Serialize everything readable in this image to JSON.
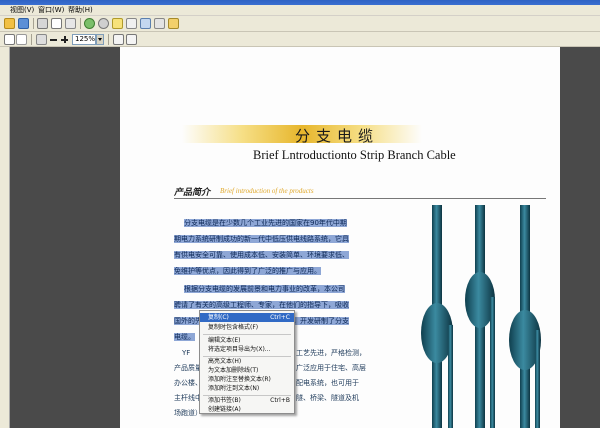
{
  "menubar": {
    "items": [
      "视图(V)",
      "窗口(W)",
      "帮助(H)"
    ]
  },
  "toolbar": {
    "zoom_value": "125%"
  },
  "document": {
    "title_cn": "分支电缆",
    "title_en": "Brief Lntroductionto Strip Branch Cable",
    "section_cn": "产品简介",
    "section_en": "Brief introduction of the products",
    "selected_lines": [
      "分支电缆是在少数几个工业先进的国家在90年代中期",
      "期电力系统研制成功的新一代中低压供电线路系统，它具",
      "有供电安全可靠、使用成本低、安装简单、环境要求低、",
      "免维护等优点，因此得到了广泛的推广与应用。",
      "根据分支电缆的发展前景和电力事业的改革，本公司",
      "聘请了有关的高级工程师、专家，在他们的指导下，吸收",
      "国外的先进技术，采用国内的先进材料，开发研制了分支",
      "电缆。"
    ],
    "lines_left": [
      "YF",
      "产品质量",
      "办公楼、",
      "主杆线中",
      "场跑道）"
    ],
    "lines_right": [
      "工艺先进，严格检测，",
      "广泛应用于住宅、高层",
      "配电系统，也可用于",
      "隧、桥梁、隧道及机",
      ""
    ]
  },
  "context_menu": {
    "items": [
      {
        "label": "复制(C)",
        "shortcut": "Ctrl+C"
      },
      {
        "label": "复制时包含格式(F)",
        "shortcut": ""
      },
      {
        "label": "编辑文本(E)",
        "shortcut": ""
      },
      {
        "label": "将选定项目导出为(X)...",
        "shortcut": ""
      },
      {
        "label": "高亮文本(H)",
        "shortcut": ""
      },
      {
        "label": "为文本加删除线(T)",
        "shortcut": ""
      },
      {
        "label": "添加附注至替换文本(R)",
        "shortcut": ""
      },
      {
        "label": "添加附注到文本(N)",
        "shortcut": ""
      },
      {
        "label": "添加书签(B)",
        "shortcut": "Ctrl+B"
      },
      {
        "label": "创建链接(A)",
        "shortcut": ""
      }
    ]
  },
  "colors": {
    "selection": "#8ea7d6",
    "menu_highlight": "#316ac5",
    "title_gold": "#e7b62c",
    "cable_teal": "#1e5c6e"
  }
}
